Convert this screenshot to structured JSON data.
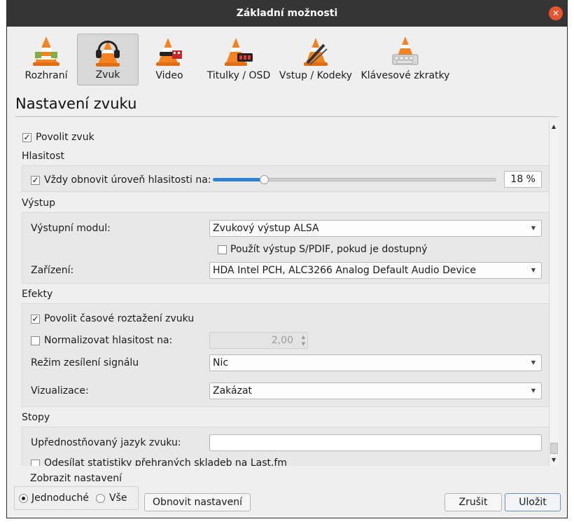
{
  "window": {
    "title": "Základní možnosti"
  },
  "toolbar": {
    "tabs": [
      {
        "label": "Rozhraní"
      },
      {
        "label": "Zvuk"
      },
      {
        "label": "Video"
      },
      {
        "label": "Titulky / OSD"
      },
      {
        "label": "Vstup / Kodeky"
      },
      {
        "label": "Klávesové zkratky"
      }
    ],
    "active_tab": "Zvuk"
  },
  "page": {
    "title": "Nastavení zvuku"
  },
  "audio": {
    "enable_label": "Povolit zvuk",
    "enable_checked": true,
    "volume_section": "Hlasitost",
    "reset_volume_label": "Vždy obnovit úroveň hlasitosti na:",
    "reset_volume_checked": true,
    "volume_value": "18 %",
    "volume_level": 18,
    "output_section": "Výstup",
    "output_module_label": "Výstupní modul:",
    "output_module_value": "Zvukový výstup ALSA",
    "spdif_label": "Použít výstup S/PDIF, pokud je dostupný",
    "spdif_checked": false,
    "device_label": "Zařízení:",
    "device_value": "HDA Intel PCH, ALC3266 Analog Default Audio Device",
    "effects_section": "Efekty",
    "time_stretch_label": "Povolit časové roztažení zvuku",
    "time_stretch_checked": true,
    "normalize_label": "Normalizovat hlasitost na:",
    "normalize_checked": false,
    "normalize_value": "2,00",
    "replay_gain_label": "Režim zesílení signálu",
    "replay_gain_value": "Nic",
    "visualization_label": "Vizualizace:",
    "visualization_value": "Zakázat",
    "tracks_section": "Stopy",
    "preferred_lang_label": "Upřednostňovaný jazyk zvuku:",
    "preferred_lang_value": "",
    "lastfm_label": "Odesílat statistiky přehraných skladeb na Last.fm",
    "lastfm_checked": false
  },
  "footer": {
    "show_settings_label": "Zobrazit nastavení",
    "simple_label": "Jednoduché",
    "all_label": "Vše",
    "simple_selected": true,
    "reset_button": "Obnovit nastavení",
    "cancel_button": "Zrušit",
    "save_button": "Uložit"
  },
  "icons": {
    "close": "close-icon",
    "tab_icons": [
      "vlc-cone-icon",
      "vlc-cone-headphones-icon",
      "vlc-cone-film-icon",
      "vlc-cone-clock-icon",
      "vlc-cone-film-strip-icon",
      "vlc-cone-keyboard-icon"
    ]
  },
  "colors": {
    "accent": "#2f7fd3",
    "titlebar": "#353535",
    "close": "#e9542d",
    "cone_orange": "#f58220"
  }
}
